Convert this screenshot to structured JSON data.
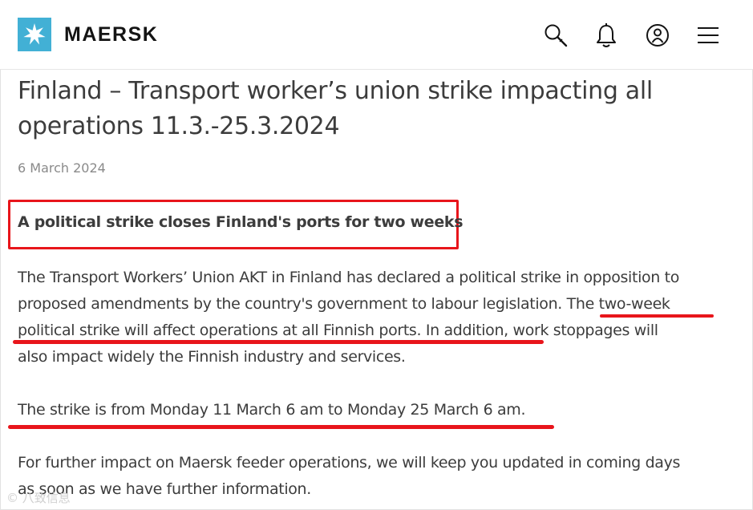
{
  "brand": {
    "name": "MAERSK",
    "logo_color": "#42b0d5"
  },
  "header": {
    "icons": [
      "search-icon",
      "bell-icon",
      "user-icon",
      "menu-icon"
    ]
  },
  "article": {
    "title_line1": "Finland – Transport worker’s union strike impacting all",
    "title_line2": "operations 11.3.-25.3.2024",
    "date": "6 March 2024",
    "subheading": "A political strike closes Finland's ports for two weeks",
    "paragraph1_lines": [
      "The Transport Workers’ Union AKT in Finland has declared a political strike in opposition to",
      "proposed amendments by the country's government to labour legislation. The two-week",
      "political strike will affect operations at all Finnish ports. In addition, work stoppages will",
      "also impact widely the Finnish industry and services."
    ],
    "paragraph2": "The strike is from Monday 11 March 6 am to Monday 25 March 6 am.",
    "paragraph3_lines": [
      "For further impact on Maersk feeder operations, we will keep you updated in coming days",
      "as soon as we have further information."
    ]
  },
  "annotations": {
    "highlight_color": "#e8151b"
  },
  "watermark": {
    "text": "© 八致信息"
  }
}
